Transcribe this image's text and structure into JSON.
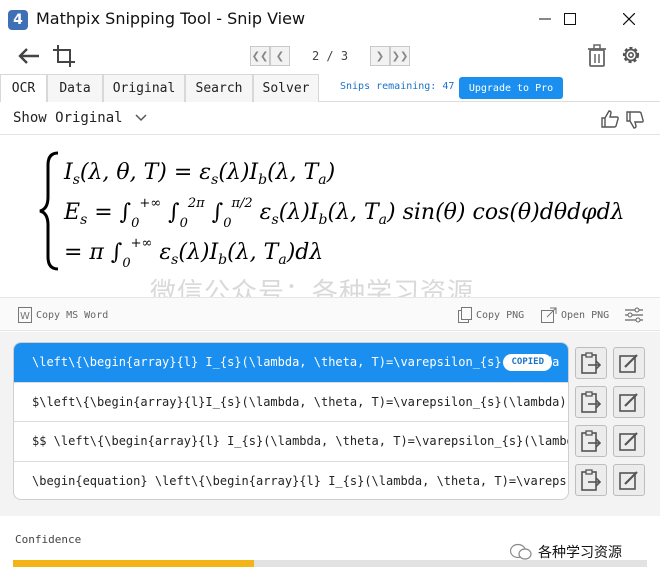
{
  "window": {
    "title": "Mathpix Snipping Tool - Snip View",
    "app_icon_glyph": "4"
  },
  "toolbar": {
    "page_counter": "2 / 3"
  },
  "tabs": [
    {
      "label": "OCR",
      "active": true
    },
    {
      "label": "Data",
      "active": false
    },
    {
      "label": "Original",
      "active": false
    },
    {
      "label": "Search",
      "active": false
    },
    {
      "label": "Solver",
      "active": false
    }
  ],
  "snips_remaining": "Snips remaining: 47",
  "upgrade_label": "Upgrade to Pro",
  "show_original_label": "Show Original",
  "watermark": "微信公众号：各种学习资源",
  "actions": {
    "copy_ms_word": "Copy MS Word",
    "copy_png": "Copy PNG",
    "open_png": "Open PNG"
  },
  "results": [
    {
      "text": "\\left\\{\\begin{array}{l} I_{s}(\\lambda, \\theta, T)=\\varepsilon_{s}(\\lambda",
      "selected": true,
      "badge": "COPIED"
    },
    {
      "text": "$\\left\\{\\begin{array}{l}I_{s}(\\lambda, \\theta, T)=\\varepsilon_{s}(\\lambda)",
      "selected": false
    },
    {
      "text": "$$  \\left\\{\\begin{array}{l} I_{s}(\\lambda, \\theta, T)=\\varepsilon_{s}(\\lambda",
      "selected": false
    },
    {
      "text": "\\begin{equation}  \\left\\{\\begin{array}{l} I_{s}(\\lambda, \\theta, T)=\\vareps",
      "selected": false
    }
  ],
  "confidence": {
    "label": "Confidence",
    "fraction": 0.38
  },
  "wechat_label": "各种学习资源",
  "colors": {
    "accent": "#1a8ff0",
    "confidence_fill": "#f2b416"
  },
  "icons": [
    "back-arrow-icon",
    "crop-icon",
    "first-page-icon",
    "prev-page-icon",
    "next-page-icon",
    "last-page-icon",
    "trash-icon",
    "gear-icon",
    "chevron-down-icon",
    "thumbs-up-icon",
    "thumbs-down-icon",
    "word-icon",
    "copy-icon",
    "open-external-icon",
    "sliders-icon",
    "paste-icon",
    "edit-icon",
    "wechat-icon"
  ]
}
